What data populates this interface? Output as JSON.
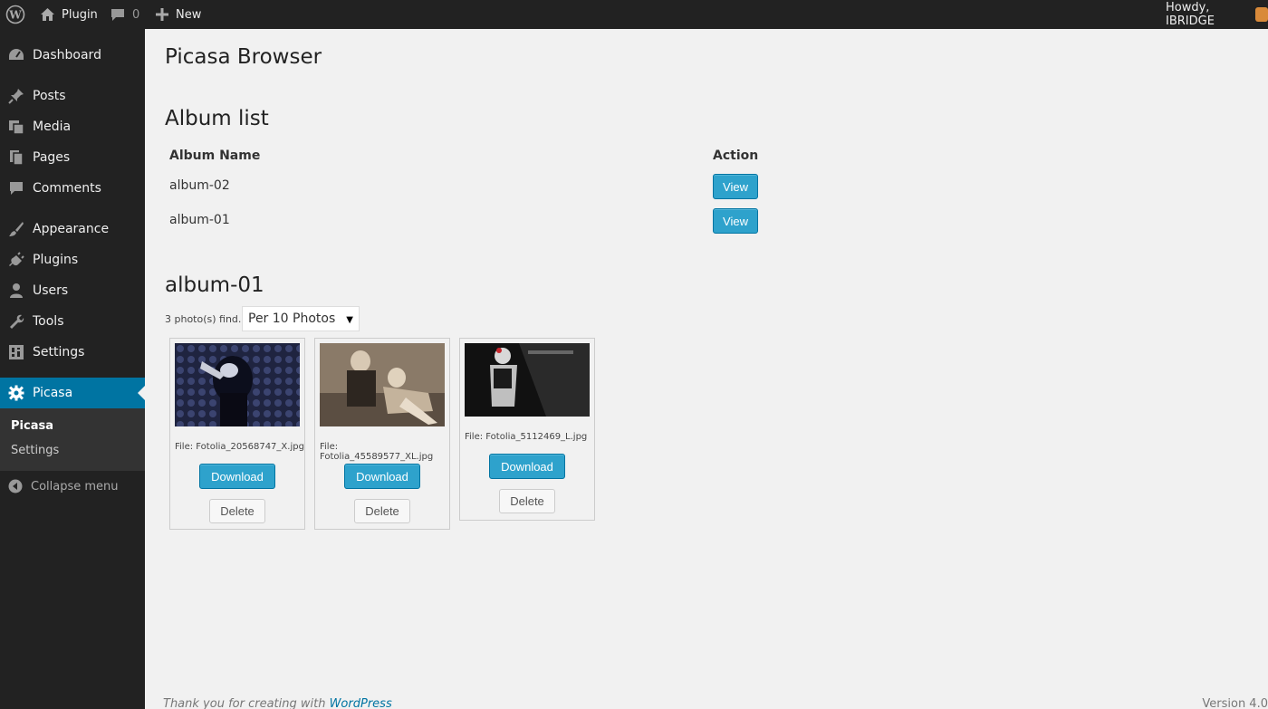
{
  "adminbar": {
    "site_name": "Plugin",
    "comments_count": "0",
    "new_label": "New",
    "howdy": "Howdy, IBRIDGE"
  },
  "sidebar": {
    "items": [
      {
        "label": "Dashboard",
        "icon": "dashboard-icon"
      },
      {
        "label": "Posts",
        "icon": "pin-icon"
      },
      {
        "label": "Media",
        "icon": "media-icon"
      },
      {
        "label": "Pages",
        "icon": "pages-icon"
      },
      {
        "label": "Comments",
        "icon": "comment-icon"
      },
      {
        "label": "Appearance",
        "icon": "brush-icon"
      },
      {
        "label": "Plugins",
        "icon": "plug-icon"
      },
      {
        "label": "Users",
        "icon": "user-icon"
      },
      {
        "label": "Tools",
        "icon": "wrench-icon"
      },
      {
        "label": "Settings",
        "icon": "settings-icon"
      },
      {
        "label": "Picasa",
        "icon": "gear-icon"
      }
    ],
    "submenu": [
      "Picasa",
      "Settings"
    ],
    "collapse_label": "Collapse menu"
  },
  "page": {
    "title": "Picasa Browser",
    "album_list_heading": "Album list",
    "col_album_name": "Album Name",
    "col_action": "Action",
    "albums": [
      {
        "name": "album-02",
        "action": "View"
      },
      {
        "name": "album-01",
        "action": "View"
      }
    ],
    "current_album": "album-01",
    "photo_count_text": "3 photo(s) find.",
    "per_page_selected": "Per 10 Photos",
    "photos": [
      {
        "file": "File: Fotolia_20568747_X.jpg",
        "download": "Download",
        "delete": "Delete"
      },
      {
        "file": "File: Fotolia_45589577_XL.jpg",
        "download": "Download",
        "delete": "Delete"
      },
      {
        "file": "File: Fotolia_5112469_L.jpg",
        "download": "Download",
        "delete": "Delete"
      }
    ]
  },
  "footer": {
    "thanks_prefix": "Thank you for creating with ",
    "thanks_link": "WordPress",
    "version": "Version 4.0"
  },
  "colors": {
    "admin_bar": "#222222",
    "active_menu": "#0074a2",
    "primary_button": "#2ea2cc"
  }
}
